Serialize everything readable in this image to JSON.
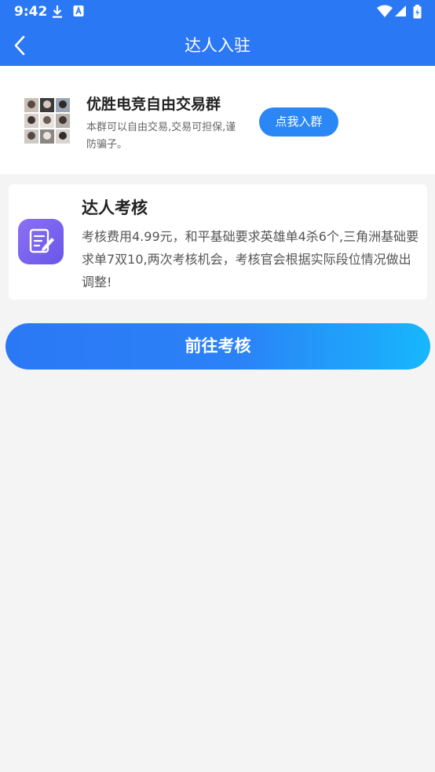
{
  "status_bar": {
    "time": "9:42"
  },
  "header": {
    "title": "达人入驻"
  },
  "group": {
    "title": "优胜电竞自由交易群",
    "description": "本群可以自由交易,交易可担保,谨防骗子。",
    "join_label": "点我入群"
  },
  "audit": {
    "title": "达人考核",
    "description": "考核费用4.99元，和平基础要求英雄单4杀6个,三角洲基础要求单7双10,两次考核机会，考核官会根据实际段位情况做出调整!"
  },
  "action": {
    "go_label": "前往考核"
  },
  "colors": {
    "primary": "#2b78f5",
    "gradient_end": "#17b7fc",
    "icon_purple": "#7a63ef"
  }
}
